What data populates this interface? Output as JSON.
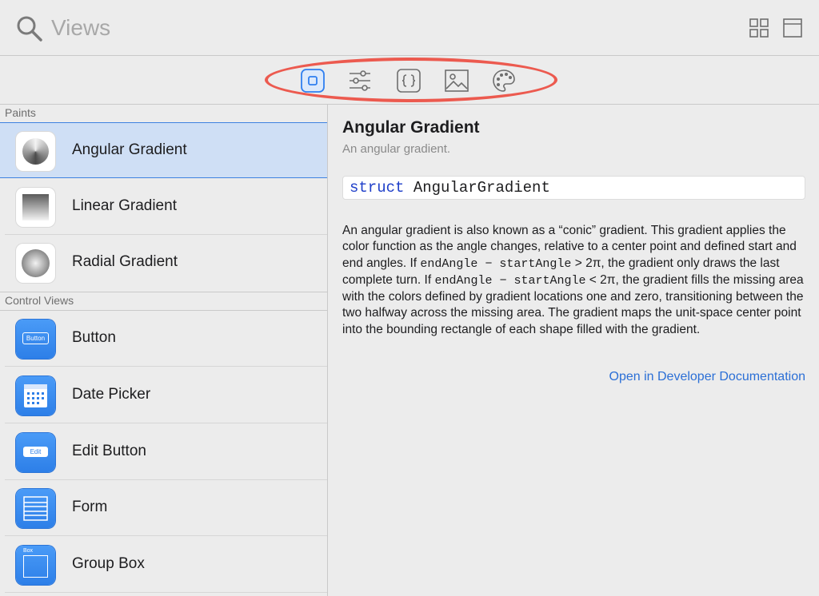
{
  "search": {
    "placeholder": "Views",
    "value": ""
  },
  "toolbar": {
    "grid_view_icon": "grid-view-icon",
    "single_view_icon": "single-view-icon"
  },
  "library_tabs": [
    {
      "name": "views",
      "icon": "views-icon",
      "selected": true
    },
    {
      "name": "modifiers",
      "icon": "sliders-icon",
      "selected": false
    },
    {
      "name": "snippets",
      "icon": "braces-icon",
      "selected": false
    },
    {
      "name": "media",
      "icon": "image-icon",
      "selected": false
    },
    {
      "name": "colors",
      "icon": "palette-icon",
      "selected": false
    }
  ],
  "highlight_color": "#ec5a4f",
  "accent_color": "#2b6fd6",
  "sections": [
    {
      "title": "Paints",
      "items": [
        {
          "label": "Angular Gradient",
          "icon": "angular-gradient-icon",
          "selected": true
        },
        {
          "label": "Linear Gradient",
          "icon": "linear-gradient-icon",
          "selected": false
        },
        {
          "label": "Radial Gradient",
          "icon": "radial-gradient-icon",
          "selected": false
        }
      ]
    },
    {
      "title": "Control Views",
      "items": [
        {
          "label": "Button",
          "icon": "button-icon",
          "icon_text": "Button",
          "selected": false
        },
        {
          "label": "Date Picker",
          "icon": "date-picker-icon",
          "selected": false
        },
        {
          "label": "Edit Button",
          "icon": "edit-button-icon",
          "icon_text": "Edit",
          "selected": false
        },
        {
          "label": "Form",
          "icon": "form-icon",
          "selected": false
        },
        {
          "label": "Group Box",
          "icon": "group-box-icon",
          "icon_text": "Box",
          "selected": false
        }
      ]
    }
  ],
  "detail": {
    "title": "Angular Gradient",
    "subtitle": "An angular gradient.",
    "declaration_keyword": "struct",
    "declaration_name": "AngularGradient",
    "body_1": "An angular gradient is also known as a “conic” gradient. This gradient applies the color function as the angle changes, relative to a center point and defined start and end angles. If ",
    "code_1": "endAngle − startAngle",
    "body_2": " > 2π, the gradient only draws the last complete turn. If ",
    "code_2": "endAngle − startAngle",
    "body_3": " < 2π, the gradient fills the missing area with the colors defined by gradient locations one and zero, transitioning between the two halfway across the missing area. The gradient maps the unit-space center point into the bounding rectangle of each shape filled with the gradient.",
    "link": "Open in Developer Documentation"
  }
}
